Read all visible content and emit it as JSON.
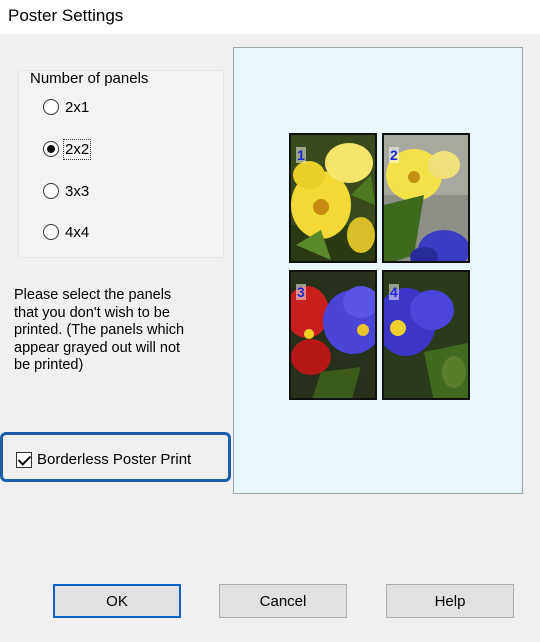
{
  "window": {
    "title": "Poster Settings"
  },
  "panels_group": {
    "label": "Number of panels",
    "options": [
      {
        "label": "2x1",
        "selected": false
      },
      {
        "label": "2x2",
        "selected": true
      },
      {
        "label": "3x3",
        "selected": false
      },
      {
        "label": "4x4",
        "selected": false
      }
    ]
  },
  "instructions": "Please select the panels\nthat you don't wish to be\nprinted. (The panels which\nappear grayed out will not\nbe printed)",
  "borderless": {
    "label": "Borderless Poster Print",
    "checked": true
  },
  "preview": {
    "background": "#e9f7fa",
    "panels": [
      {
        "number": "1"
      },
      {
        "number": "2"
      },
      {
        "number": "3"
      },
      {
        "number": "4"
      }
    ]
  },
  "buttons": {
    "ok": "OK",
    "cancel": "Cancel",
    "help": "Help"
  },
  "colors": {
    "highlight": "#1a5ea9",
    "panel_number": "#1b2bd0",
    "default_button_border": "#0a64c8"
  }
}
